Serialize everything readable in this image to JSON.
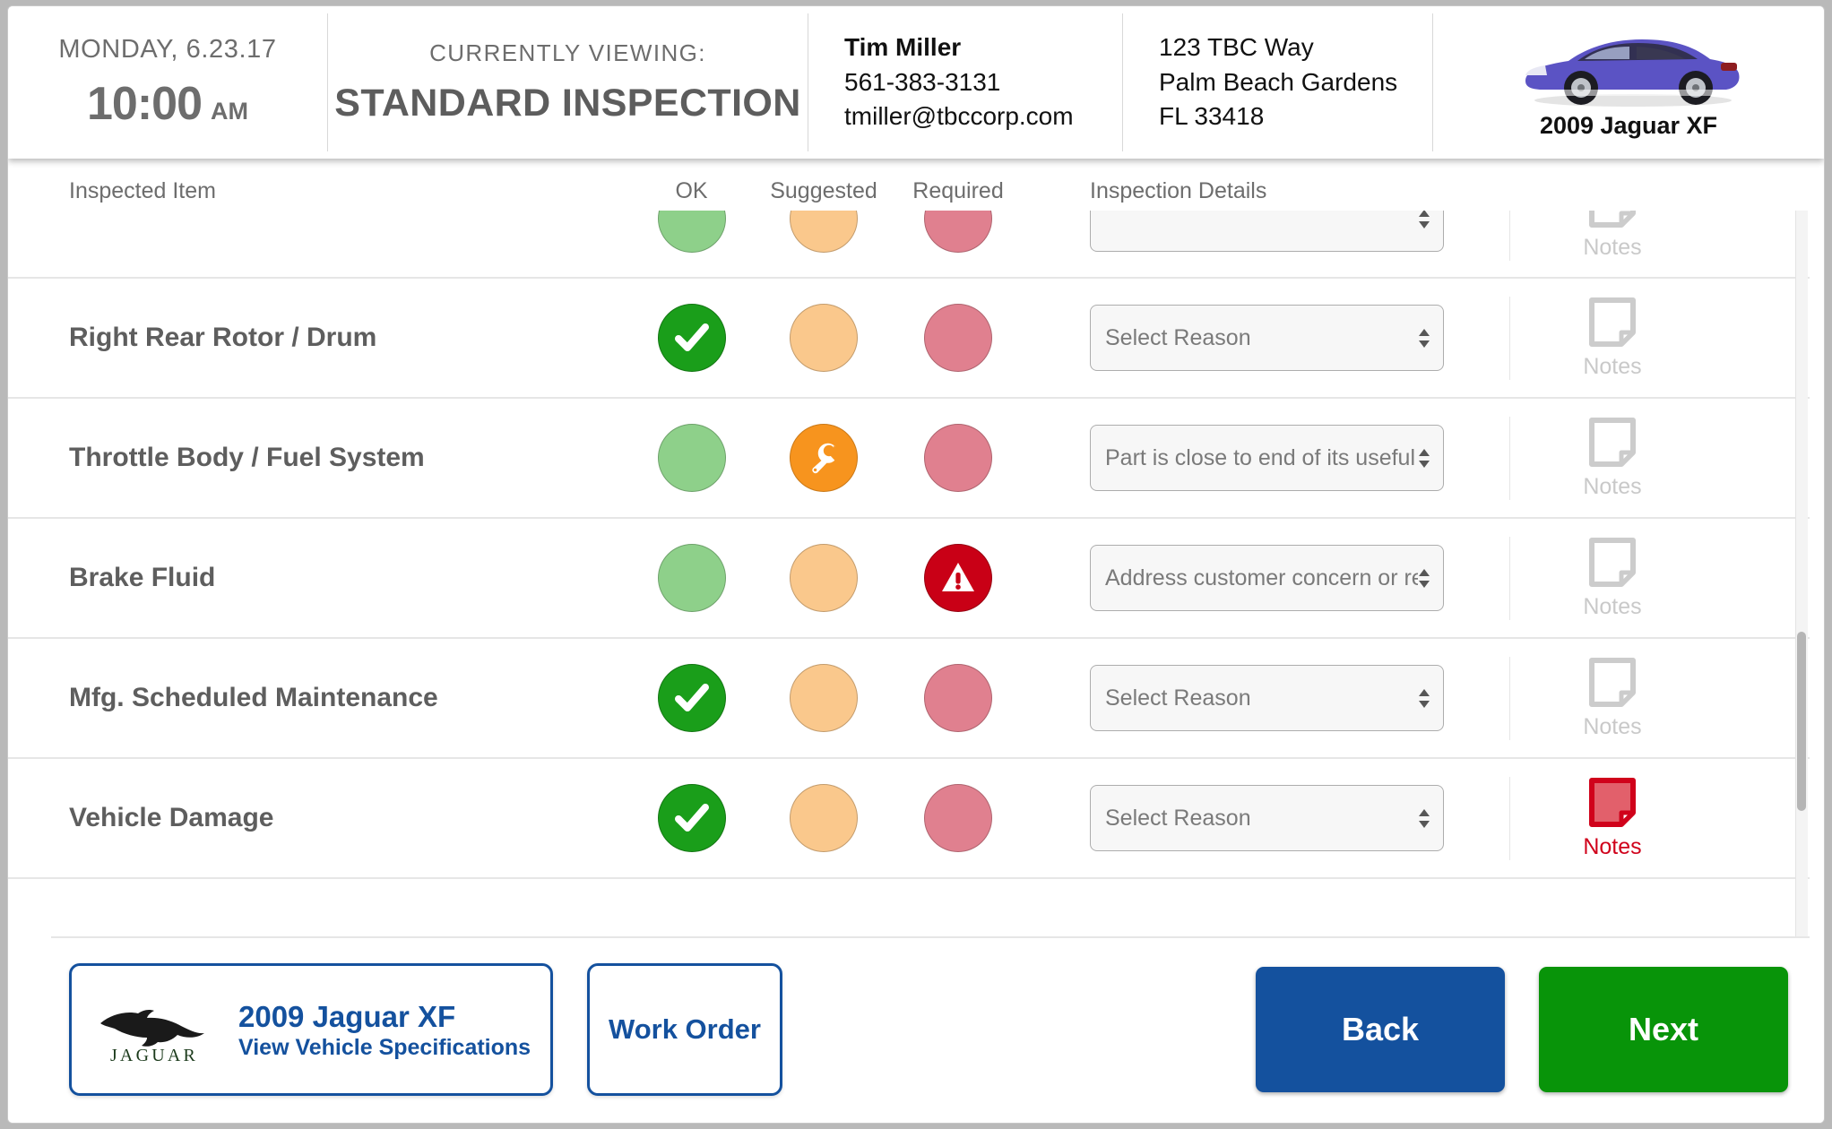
{
  "header": {
    "date": "MONDAY, 6.23.17",
    "time": "10:00",
    "ampm": "AM",
    "viewing_label": "CURRENTLY VIEWING:",
    "viewing_title": "STANDARD INSPECTION",
    "contact": {
      "name": "Tim Miller",
      "phone": "561-383-3131",
      "email": "tmiller@tbccorp.com"
    },
    "address": {
      "line1": "123 TBC Way",
      "line2": "Palm Beach Gardens",
      "line3": "FL 33418"
    },
    "vehicle_name": "2009 Jaguar XF",
    "vehicle_color": "#5b53c4"
  },
  "table": {
    "columns": {
      "item": "Inspected Item",
      "ok": "OK",
      "suggested": "Suggested",
      "required": "Required",
      "details": "Inspection Details",
      "notes": "Notes"
    },
    "select_placeholder": "Select Reason",
    "notes_label": "Notes",
    "rows": [
      {
        "item": "",
        "ok": "off",
        "suggested": "off",
        "required": "off",
        "detail": "",
        "notes_state": "empty",
        "partial": true
      },
      {
        "item": "Right Rear Rotor / Drum",
        "ok": "on",
        "suggested": "off",
        "required": "off",
        "detail": "Select Reason",
        "notes_state": "empty"
      },
      {
        "item": "Throttle Body / Fuel System",
        "ok": "off",
        "suggested": "on",
        "required": "off",
        "detail": "Part is close to end of its useful life.",
        "notes_state": "empty"
      },
      {
        "item": "Brake Fluid",
        "ok": "off",
        "suggested": "off",
        "required": "on",
        "detail": "Address customer concern or request.",
        "notes_state": "empty"
      },
      {
        "item": "Mfg. Scheduled Maintenance",
        "ok": "on",
        "suggested": "off",
        "required": "off",
        "detail": "Select Reason",
        "notes_state": "empty"
      },
      {
        "item": "Vehicle Damage",
        "ok": "on",
        "suggested": "off",
        "required": "off",
        "detail": "Select Reason",
        "notes_state": "flagged"
      }
    ]
  },
  "footer": {
    "vehicle_button": {
      "title": "2009 Jaguar XF",
      "subtitle": "View Vehicle Specifications",
      "brand": "JAGUAR"
    },
    "work_order": "Work Order",
    "back": "Back",
    "next": "Next"
  },
  "colors": {
    "brand_blue": "#14519e",
    "next_green": "#089409",
    "ok_green": "#1a9e1a",
    "suggested_orange": "#f7941e",
    "required_red": "#c90016",
    "notes_flag_red": "#d0021b"
  }
}
